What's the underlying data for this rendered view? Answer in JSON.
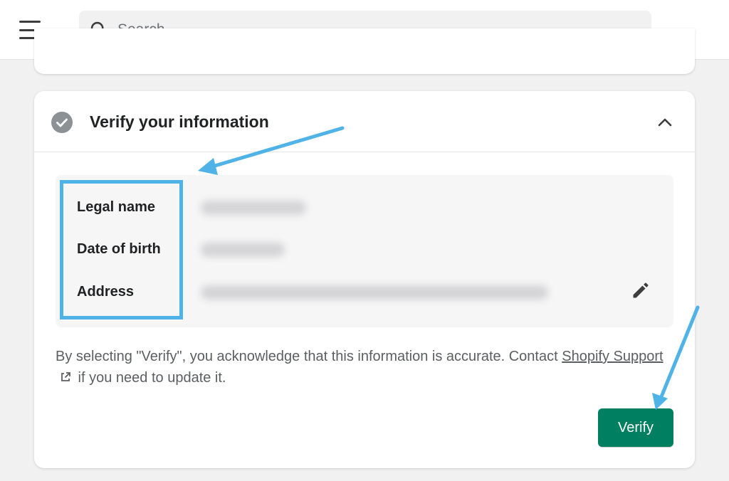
{
  "search": {
    "placeholder": "Search"
  },
  "card": {
    "title": "Verify your information",
    "fields": [
      {
        "label": "Legal name"
      },
      {
        "label": "Date of birth"
      },
      {
        "label": "Address"
      }
    ],
    "notice_before_link": "By selecting \"Verify\", you acknowledge that this information is accurate. Contact ",
    "notice_link": "Shopify Support",
    "notice_after_link": " if you need to update it.",
    "verify_label": "Verify"
  },
  "colors": {
    "primary": "#008060",
    "annotation": "#4fb3e8",
    "check": "#8c9196"
  },
  "icons": [
    "menu-icon",
    "search-icon",
    "check-circle-icon",
    "chevron-up-icon",
    "pencil-icon",
    "external-link-icon"
  ]
}
